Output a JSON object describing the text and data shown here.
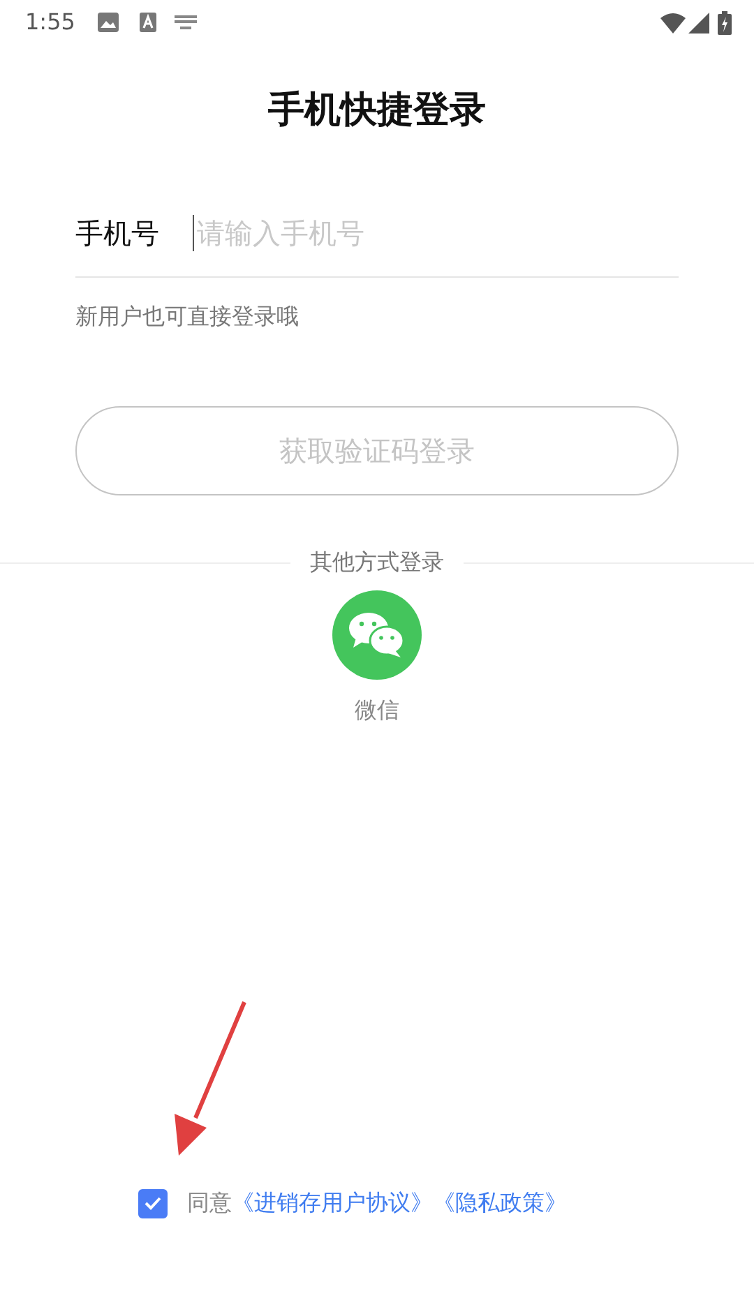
{
  "status_bar": {
    "time": "1:55"
  },
  "title": "手机快捷登录",
  "phone_field": {
    "label": "手机号",
    "placeholder": "请输入手机号",
    "focused": true
  },
  "hint": "新用户也可直接登录哦",
  "login_button": {
    "label": "获取验证码登录",
    "disabled": true
  },
  "other_login": {
    "heading": "其他方式登录",
    "options": [
      {
        "kind": "wechat",
        "label": "微信"
      }
    ]
  },
  "agreement": {
    "checked": true,
    "text": "同意",
    "links": [
      "《进销存用户协议》",
      "《隐私政策》"
    ]
  }
}
